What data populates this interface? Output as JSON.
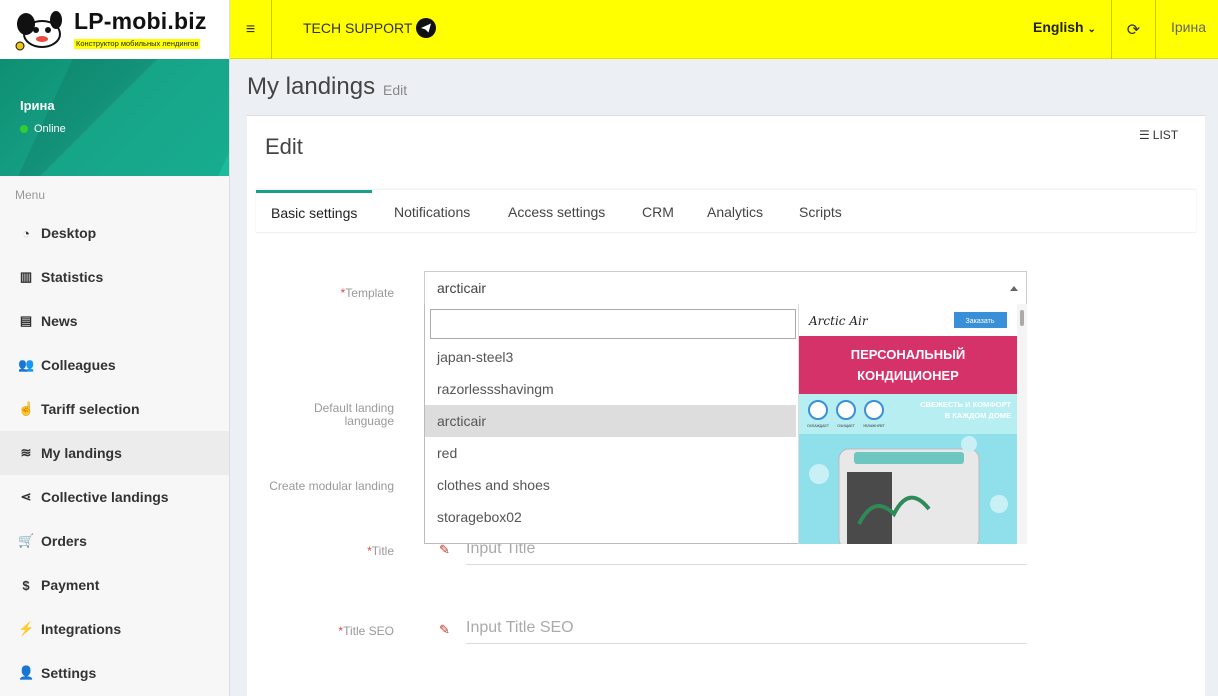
{
  "brand": {
    "name": "LP-mobi.biz",
    "tagline": "Конструктор мобильных лендингов"
  },
  "topbar": {
    "support_label": "TECH SUPPORT",
    "language": "English",
    "user": "Ірина"
  },
  "sidebar": {
    "user_name": "Ірина",
    "status": "Online",
    "menu_header": "Menu",
    "items": [
      {
        "label": "Desktop",
        "icon": "dashboard-icon"
      },
      {
        "label": "Statistics",
        "icon": "bar-chart-icon"
      },
      {
        "label": "News",
        "icon": "newspaper-icon"
      },
      {
        "label": "Colleagues",
        "icon": "users-icon"
      },
      {
        "label": "Tariff selection",
        "icon": "hand-pointer-icon"
      },
      {
        "label": "My landings",
        "icon": "stack-icon"
      },
      {
        "label": "Collective landings",
        "icon": "share-icon"
      },
      {
        "label": "Orders",
        "icon": "cart-icon"
      },
      {
        "label": "Payment",
        "icon": "dollar-icon"
      },
      {
        "label": "Integrations",
        "icon": "plug-icon"
      },
      {
        "label": "Settings",
        "icon": "user-icon"
      }
    ]
  },
  "page": {
    "title": "My landings",
    "subtitle": "Edit"
  },
  "box": {
    "title": "Edit",
    "list_label": "LIST"
  },
  "tabs": [
    "Basic settings",
    "Notifications",
    "Access settings",
    "CRM",
    "Analytics",
    "Scripts"
  ],
  "form": {
    "template_label": "Template",
    "template_value": "arcticair",
    "language_label_1": "Default landing",
    "language_label_2": "language",
    "modular_label": "Create modular landing",
    "title_label": "Title",
    "title_placeholder": "Input Title",
    "title_seo_label": "Title SEO",
    "title_seo_placeholder": "Input Title SEO",
    "required_mark": "*"
  },
  "dropdown": {
    "options": [
      "japan-steel3",
      "razorlessshavingm",
      "arcticair",
      "red",
      "clothes and shoes",
      "storagebox02"
    ],
    "highlighted": "arcticair"
  },
  "preview": {
    "brand": "Arctic Air",
    "order_button": "Заказать",
    "headline_1": "ПЕРСОНАЛЬНЫЙ",
    "headline_2": "КОНДИЦИОНЕР",
    "slogan_1": "СВЕЖЕСТЬ И КОМФОРТ",
    "slogan_2": "В КАЖДОМ ДОМЕ",
    "feature_1": "ОХЛАЖДАЕТ",
    "feature_2": "ОЧИЩАЕТ",
    "feature_3": "УВЛАЖНЯЕТ",
    "colors": {
      "banner": "#d6326a",
      "accent": "#3a8fd9",
      "sky": "#8fe0ea"
    }
  }
}
